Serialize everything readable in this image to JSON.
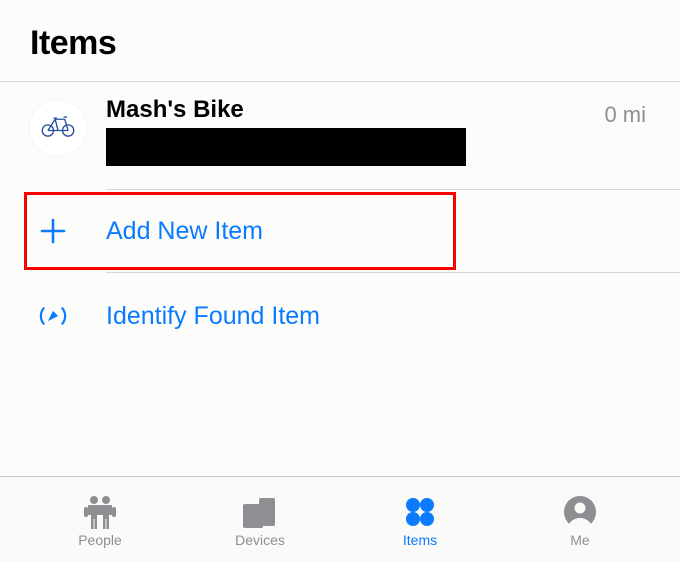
{
  "header": {
    "title": "Items"
  },
  "items": [
    {
      "name": "Mash's Bike",
      "distance": "0 mi"
    }
  ],
  "actions": {
    "add_new_item": "Add New Item",
    "identify_found_item": "Identify Found Item"
  },
  "tabs": {
    "people": "People",
    "devices": "Devices",
    "items": "Items",
    "me": "Me"
  },
  "colors": {
    "accent": "#0b7aff",
    "inactive": "#8e8e93"
  }
}
